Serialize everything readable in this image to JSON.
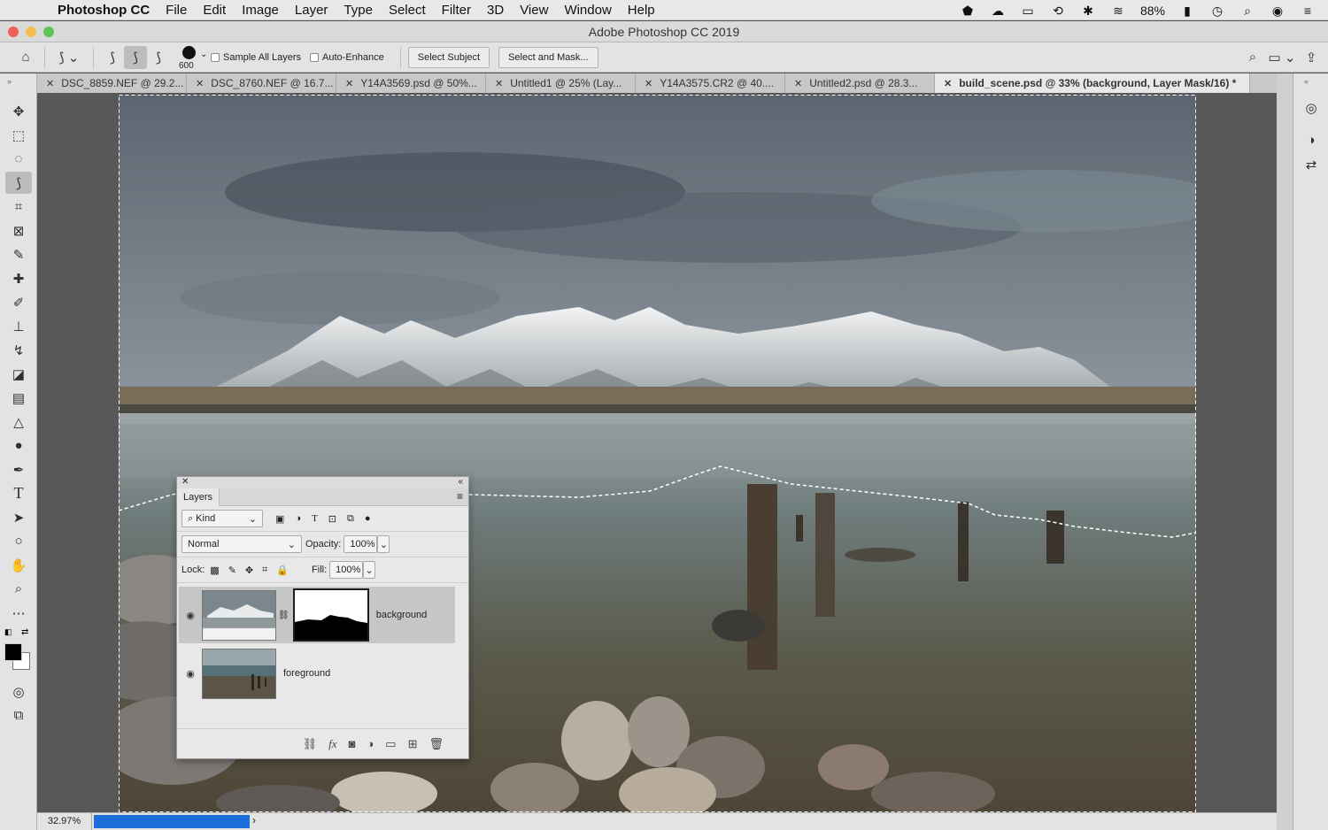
{
  "menubar": {
    "app_name": "Photoshop CC",
    "items": [
      "File",
      "Edit",
      "Image",
      "Layer",
      "Type",
      "Select",
      "Filter",
      "3D",
      "View",
      "Window",
      "Help"
    ],
    "battery_percent": "88%"
  },
  "window": {
    "title": "Adobe Photoshop CC 2019"
  },
  "options": {
    "brush_size": "600",
    "sample_all_layers": "Sample All Layers",
    "auto_enhance": "Auto-Enhance",
    "select_subject": "Select Subject",
    "select_and_mask": "Select and Mask..."
  },
  "tabs": [
    "DSC_8859.NEF @ 29.2...",
    "DSC_8760.NEF @ 16.7...",
    "Y14A3569.psd @ 50%...",
    "Untitled1 @ 25% (Lay...",
    "Y14A3575.CR2 @ 40....",
    "Untitled2.psd @ 28.3...",
    "build_scene.psd @ 33% (background, Layer Mask/16) *"
  ],
  "status": {
    "zoom": "32.97%",
    "progress_fraction": 1.0
  },
  "layers_panel": {
    "title": "Layers",
    "filter_kind": "Kind",
    "blend_mode": "Normal",
    "opacity_label": "Opacity:",
    "opacity_value": "100%",
    "lock_label": "Lock:",
    "fill_label": "Fill:",
    "fill_value": "100%",
    "layers": [
      {
        "name": "background",
        "selected": true,
        "has_mask": true
      },
      {
        "name": "foreground",
        "selected": false,
        "has_mask": false
      }
    ]
  },
  "colors": {
    "accent_blue": "#1b6fd8",
    "panel_bg": "#e3e3e3",
    "canvas_bg": "#585858"
  }
}
